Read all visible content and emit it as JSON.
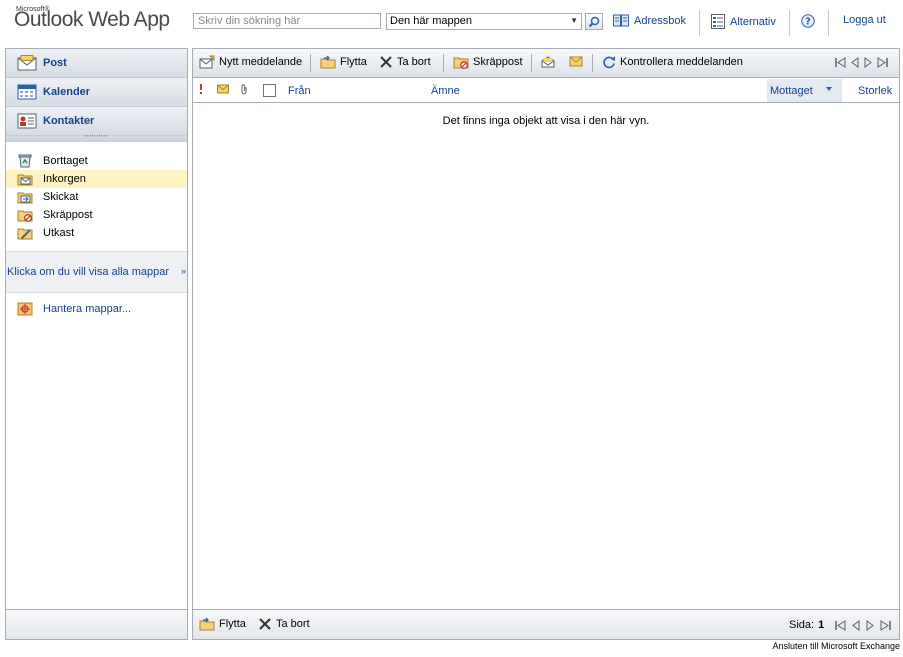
{
  "header": {
    "logo_top": "Microsoft®",
    "logo_main": "Outlook Web App",
    "search_placeholder": "Skriv din sökning här",
    "search_scope": "Den här mappen",
    "scope_options": [
      "Den här mappen"
    ],
    "address_book": "Adressbok",
    "options": "Alternativ",
    "sign_out": "Logga ut"
  },
  "nav": {
    "modules": [
      {
        "label": "Post",
        "icon": "mail-module-icon"
      },
      {
        "label": "Kalender",
        "icon": "calendar-module-icon"
      },
      {
        "label": "Kontakter",
        "icon": "contacts-module-icon"
      }
    ],
    "folders": [
      {
        "label": "Borttaget",
        "icon": "deleted-items-icon",
        "selected": false
      },
      {
        "label": "Inkorgen",
        "icon": "inbox-folder-icon",
        "selected": true
      },
      {
        "label": "Skickat",
        "icon": "sent-items-icon",
        "selected": false
      },
      {
        "label": "Skräppost",
        "icon": "junk-folder-icon",
        "selected": false
      },
      {
        "label": "Utkast",
        "icon": "drafts-folder-icon",
        "selected": false
      }
    ],
    "show_all_folders": "Klicka om du vill visa alla mappar",
    "manage_folders": "Hantera mappar..."
  },
  "toolbar": {
    "new_message": "Nytt meddelande",
    "move": "Flytta",
    "delete": "Ta bort",
    "junk": "Skräppost",
    "check_messages": "Kontrollera meddelanden"
  },
  "columns": {
    "from": "Från",
    "subject": "Ämne",
    "received": "Mottaget",
    "size": "Storlek"
  },
  "list": {
    "empty_message": "Det finns inga objekt att visa i den här vyn."
  },
  "footer": {
    "move": "Flytta",
    "delete": "Ta bort",
    "page_label": "Sida:",
    "page_number": "1",
    "connection_status": "Ansluten till Microsoft Exchange"
  },
  "colors": {
    "link": "#15428b",
    "border": "#a5acb5",
    "selected_folder": "#fdf3c3",
    "sorted_column": "#e5eaf1"
  }
}
